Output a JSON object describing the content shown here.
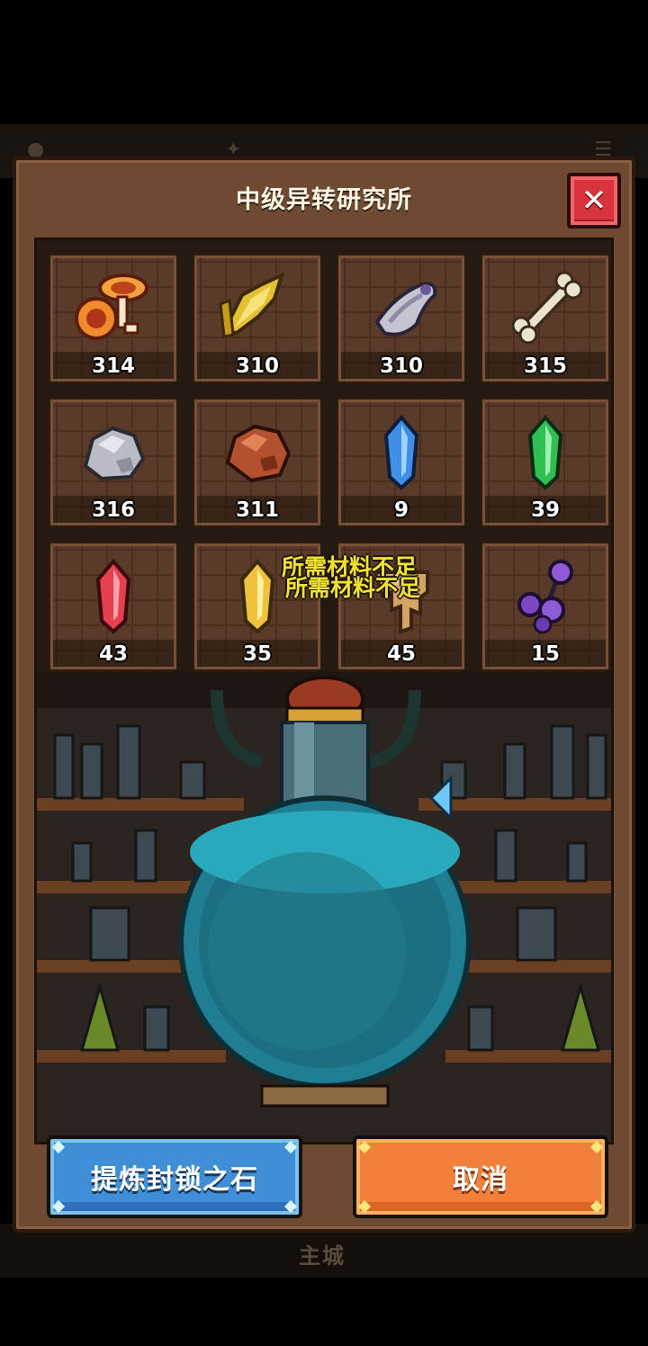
{
  "background": {
    "nav_city_label": "主城"
  },
  "dialog": {
    "title": "中级异转研究所",
    "close_icon": "close-x-icon",
    "materials": [
      {
        "icon": "mushroom-icon",
        "count": "314"
      },
      {
        "icon": "golden-feather-icon",
        "count": "310"
      },
      {
        "icon": "silver-horn-icon",
        "count": "310"
      },
      {
        "icon": "bone-icon",
        "count": "315"
      },
      {
        "icon": "iron-ore-icon",
        "count": "316"
      },
      {
        "icon": "copper-ore-icon",
        "count": "311"
      },
      {
        "icon": "blue-crystal-icon",
        "count": "9"
      },
      {
        "icon": "green-crystal-icon",
        "count": "39"
      },
      {
        "icon": "red-crystal-icon",
        "count": "43"
      },
      {
        "icon": "yellow-crystal-icon",
        "count": "35"
      },
      {
        "icon": "tan-claw-icon",
        "count": "45"
      },
      {
        "icon": "purple-berry-icon",
        "count": "15"
      }
    ],
    "toast_line1": "所需材料不足",
    "toast_line2": "所需材料不足",
    "buttons": {
      "refine_label": "提炼封锁之石",
      "cancel_label": "取消"
    }
  }
}
